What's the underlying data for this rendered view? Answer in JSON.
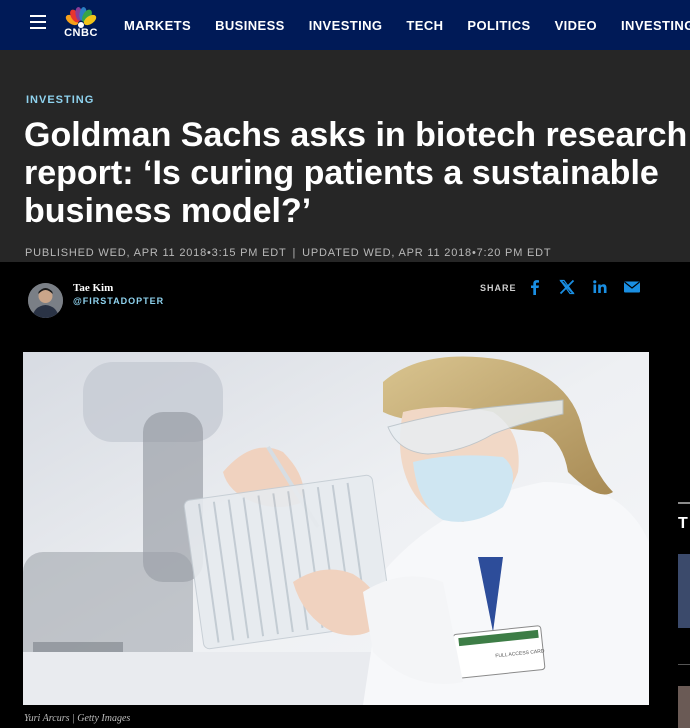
{
  "nav": {
    "logo_text": "CNBC",
    "items": [
      "MARKETS",
      "BUSINESS",
      "INVESTING",
      "TECH",
      "POLITICS",
      "VIDEO",
      "INVESTING CLUB"
    ]
  },
  "article": {
    "kicker": "INVESTING",
    "headline": "Goldman Sachs asks in biotech research report: ‘Is curing patients a sustainable business model?’",
    "published": "PUBLISHED WED, APR 11 2018•3:15 PM EDT",
    "separator": "|",
    "updated": "UPDATED WED, APR 11 2018•7:20 PM EDT"
  },
  "author": {
    "name": "Tae Kim",
    "handle": "@FIRSTADOPTER"
  },
  "share": {
    "label": "SHARE",
    "icons": [
      "facebook-icon",
      "x-icon",
      "linkedin-icon",
      "email-icon"
    ]
  },
  "image": {
    "caption": "Yuri Arcurs | Getty Images",
    "badge_text": "FULL ACCESS CARD"
  },
  "side": {
    "letter": "T"
  },
  "colors": {
    "nav_bg": "#001a57",
    "header_bg": "#262626",
    "kicker": "#8fd3ef",
    "share_icon": "#1a8fe3"
  }
}
